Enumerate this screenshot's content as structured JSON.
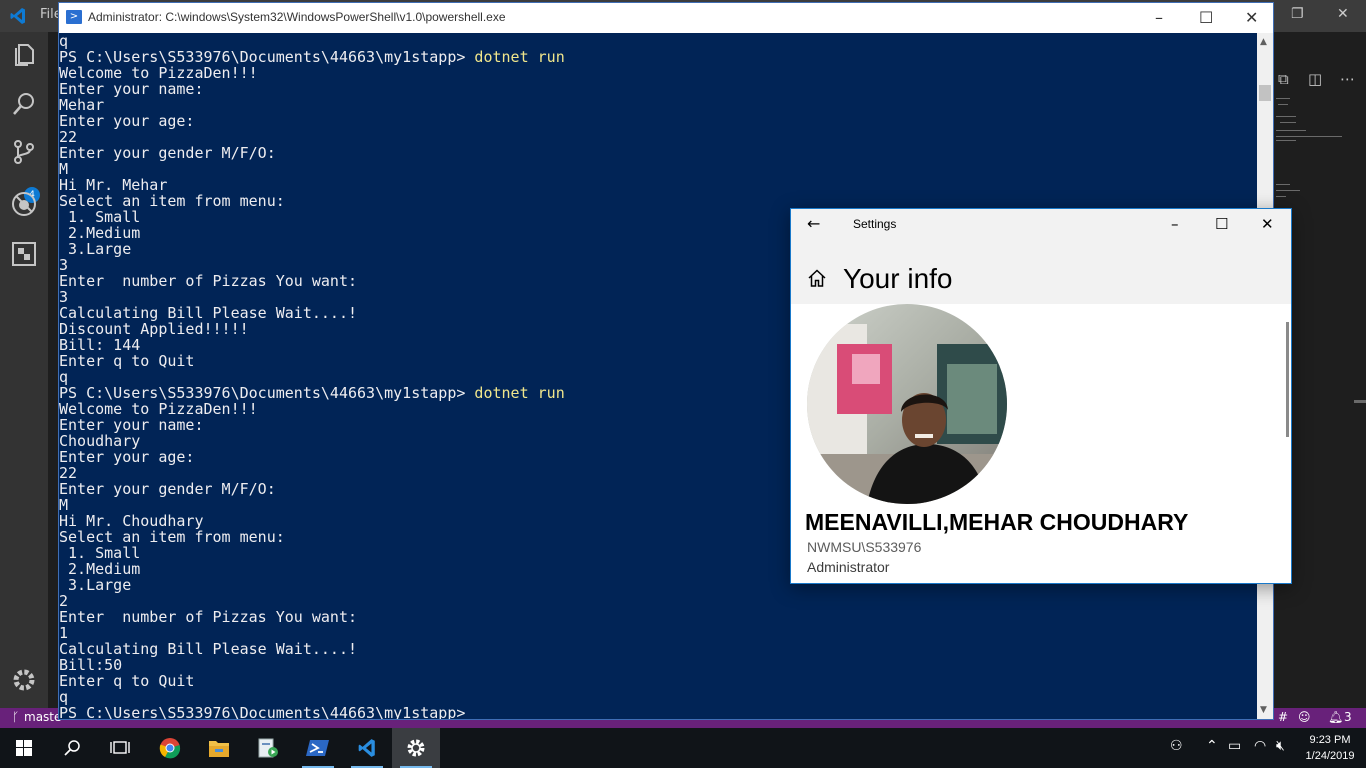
{
  "vscode": {
    "menu_partial": "File",
    "status": {
      "branch": "maste",
      "hash": "#",
      "notifications": "3"
    },
    "scm_badge": "4"
  },
  "powershell": {
    "title": "Administrator: C:\\windows\\System32\\WindowsPowerShell\\v1.0\\powershell.exe",
    "lines": [
      {
        "prompt": "q",
        "cmd": ""
      },
      {
        "prompt": "PS C:\\Users\\S533976\\Documents\\44663\\my1stapp> ",
        "cmd": "dotnet run"
      },
      {
        "prompt": "Welcome to PizzaDen!!!",
        "cmd": ""
      },
      {
        "prompt": "Enter your name:",
        "cmd": ""
      },
      {
        "prompt": "Mehar",
        "cmd": ""
      },
      {
        "prompt": "Enter your age:",
        "cmd": ""
      },
      {
        "prompt": "22",
        "cmd": ""
      },
      {
        "prompt": "Enter your gender M/F/O:",
        "cmd": ""
      },
      {
        "prompt": "M",
        "cmd": ""
      },
      {
        "prompt": "Hi Mr. Mehar",
        "cmd": ""
      },
      {
        "prompt": "Select an item from menu:",
        "cmd": ""
      },
      {
        "prompt": " 1. Small",
        "cmd": ""
      },
      {
        "prompt": " 2.Medium",
        "cmd": ""
      },
      {
        "prompt": " 3.Large",
        "cmd": ""
      },
      {
        "prompt": "3",
        "cmd": ""
      },
      {
        "prompt": "Enter  number of Pizzas You want:",
        "cmd": ""
      },
      {
        "prompt": "3",
        "cmd": ""
      },
      {
        "prompt": "Calculating Bill Please Wait....!",
        "cmd": ""
      },
      {
        "prompt": "Discount Applied!!!!!",
        "cmd": ""
      },
      {
        "prompt": "Bill: 144",
        "cmd": ""
      },
      {
        "prompt": "Enter q to Quit",
        "cmd": ""
      },
      {
        "prompt": "q",
        "cmd": ""
      },
      {
        "prompt": "PS C:\\Users\\S533976\\Documents\\44663\\my1stapp> ",
        "cmd": "dotnet run"
      },
      {
        "prompt": "Welcome to PizzaDen!!!",
        "cmd": ""
      },
      {
        "prompt": "Enter your name:",
        "cmd": ""
      },
      {
        "prompt": "Choudhary",
        "cmd": ""
      },
      {
        "prompt": "Enter your age:",
        "cmd": ""
      },
      {
        "prompt": "22",
        "cmd": ""
      },
      {
        "prompt": "Enter your gender M/F/O:",
        "cmd": ""
      },
      {
        "prompt": "M",
        "cmd": ""
      },
      {
        "prompt": "Hi Mr. Choudhary",
        "cmd": ""
      },
      {
        "prompt": "Select an item from menu:",
        "cmd": ""
      },
      {
        "prompt": " 1. Small",
        "cmd": ""
      },
      {
        "prompt": " 2.Medium",
        "cmd": ""
      },
      {
        "prompt": " 3.Large",
        "cmd": ""
      },
      {
        "prompt": "2",
        "cmd": ""
      },
      {
        "prompt": "Enter  number of Pizzas You want:",
        "cmd": ""
      },
      {
        "prompt": "1",
        "cmd": ""
      },
      {
        "prompt": "Calculating Bill Please Wait....!",
        "cmd": ""
      },
      {
        "prompt": "Bill:50",
        "cmd": ""
      },
      {
        "prompt": "Enter q to Quit",
        "cmd": ""
      },
      {
        "prompt": "q",
        "cmd": ""
      },
      {
        "prompt": "PS C:\\Users\\S533976\\Documents\\44663\\my1stapp>",
        "cmd": ""
      }
    ]
  },
  "settings": {
    "title": "Settings",
    "heading": "Your info",
    "name": "MEENAVILLI,MEHAR CHOUDHARY",
    "account": "NWMSU\\S533976",
    "role": "Administrator"
  },
  "taskbar": {
    "time": "9:23 PM",
    "date": "1/24/2019"
  },
  "colors": {
    "ps_background": "#012456",
    "ps_command": "#f0e68c",
    "vs_status": "#68217a",
    "accent": "#1979ca"
  }
}
